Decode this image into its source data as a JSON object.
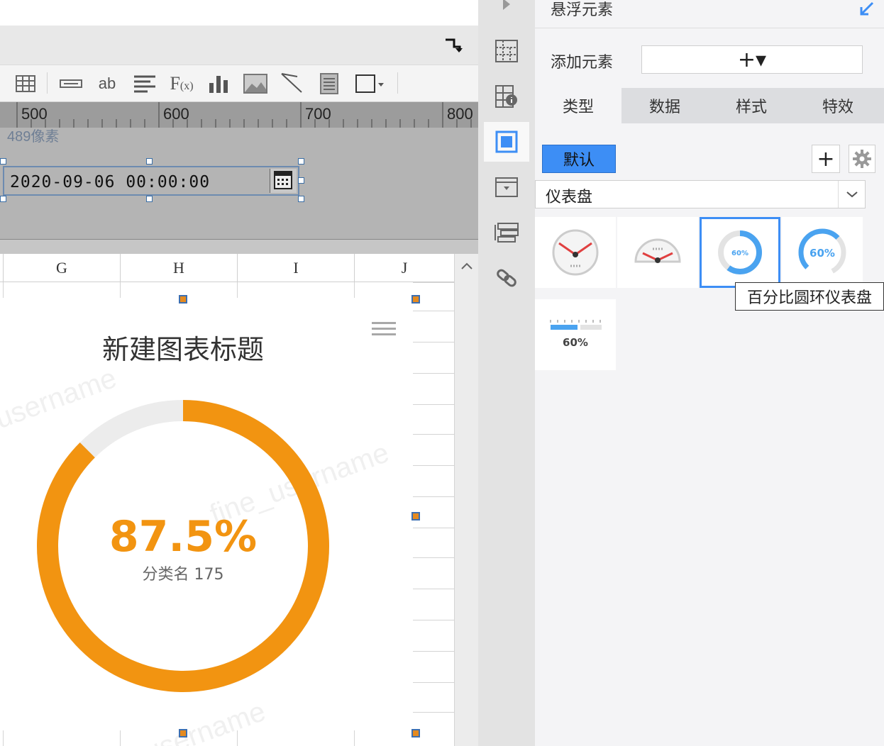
{
  "ruler": {
    "ticks": [
      "500",
      "600",
      "700",
      "800"
    ]
  },
  "canvas": {
    "pixel_label": "489像素",
    "date_value": "2020-09-06 00:00:00"
  },
  "sheet": {
    "columns": [
      "G",
      "H",
      "I",
      "J"
    ]
  },
  "chart": {
    "title": "新建图表标题",
    "value_text": "87.5%",
    "category_text": "分类名 175",
    "percent": 0.875,
    "ring_color": "#f29411",
    "track_color": "#ececec"
  },
  "watermark": {
    "text": "username",
    "text2": "fine_username"
  },
  "panel": {
    "title": "悬浮元素",
    "add_label": "添加元素",
    "add_button": "+▾",
    "tabs": [
      "类型",
      "数据",
      "样式",
      "特效"
    ],
    "default_button": "默认",
    "plus_button": "+",
    "type_select": "仪表盘",
    "gauge_labels": [
      "60%",
      "60%",
      "60%"
    ],
    "tooltip": "百分比圆环仪表盘",
    "accent": "#3d8ef5"
  }
}
